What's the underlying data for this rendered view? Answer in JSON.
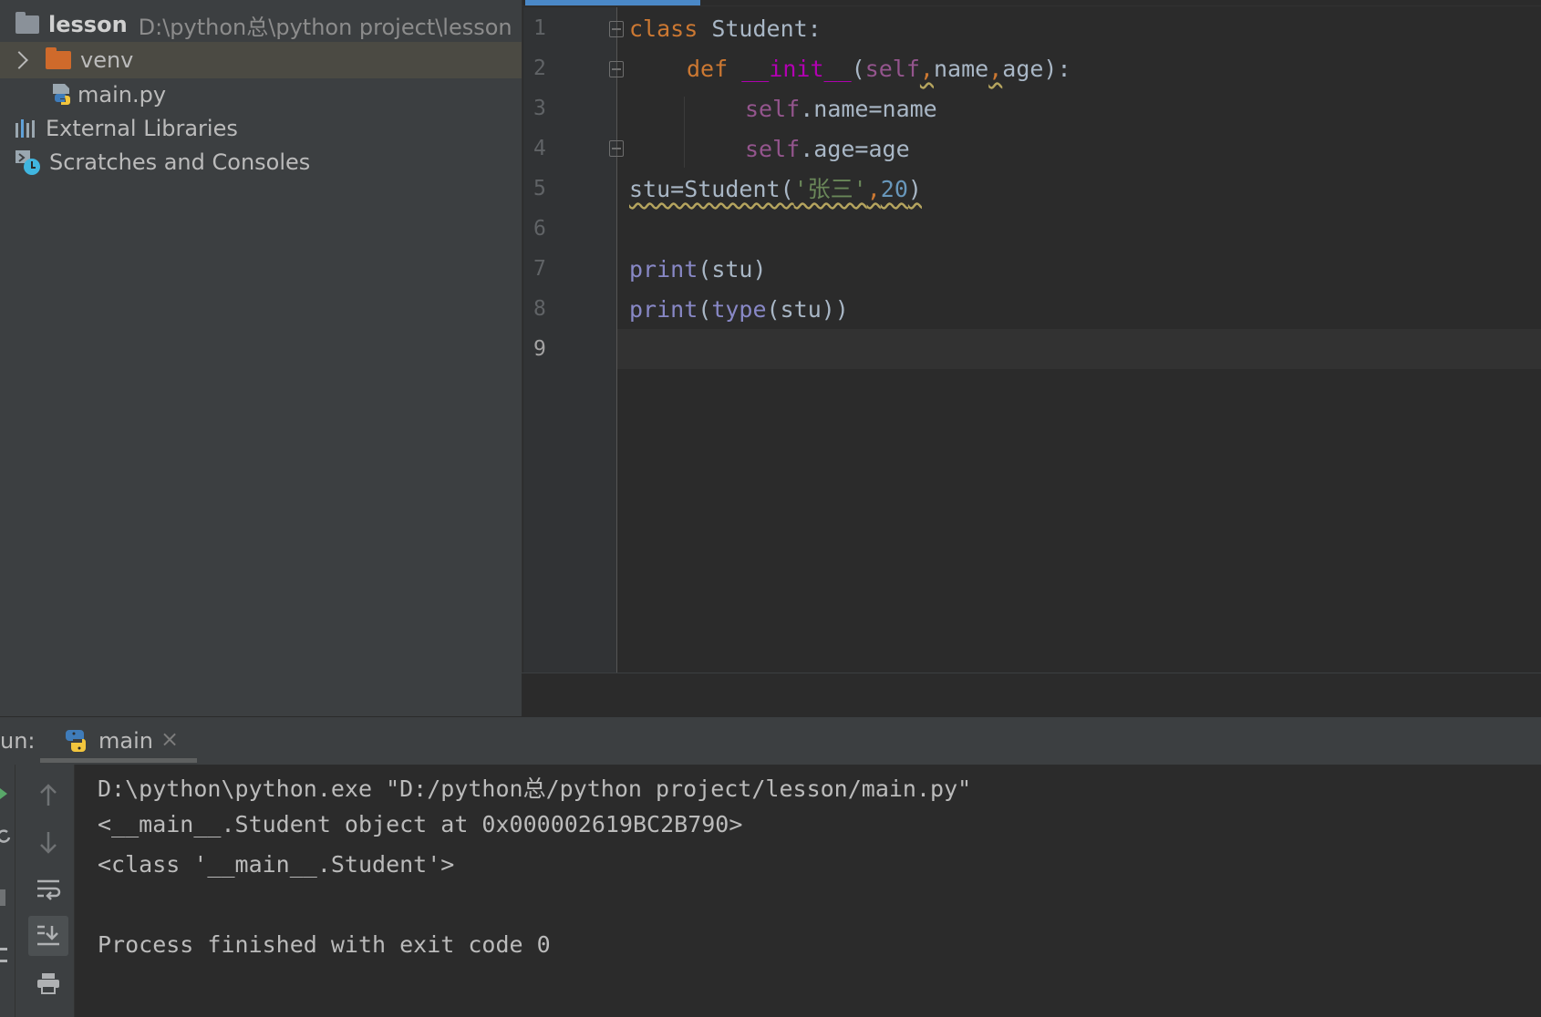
{
  "project_tree": {
    "root": {
      "name": "lesson",
      "path": "D:\\python总\\python project\\lesson"
    },
    "items": [
      {
        "label": "venv",
        "icon": "folder-icon"
      },
      {
        "label": "main.py",
        "icon": "python-file-icon"
      },
      {
        "label": "External Libraries",
        "icon": "library-icon"
      },
      {
        "label": "Scratches and Consoles",
        "icon": "scratches-icon"
      }
    ]
  },
  "editor": {
    "line_numbers": [
      "1",
      "2",
      "3",
      "4",
      "5",
      "6",
      "7",
      "8",
      "9"
    ],
    "current_line": "9",
    "code": {
      "l1": {
        "kw": "class",
        "name": " Student:"
      },
      "l2": {
        "kw": "def",
        "fn": "__init__",
        "open": "(",
        "self": "self",
        "c1": ",",
        "p1": "name",
        "c2": ",",
        "p2": "age",
        "close": "):"
      },
      "l3": {
        "self": "self",
        "rest": ".name=name"
      },
      "l4": {
        "self": "self",
        "rest": ".age=age"
      },
      "l5": {
        "pre": "stu=Student(",
        "str": "'张三'",
        "comma": ",",
        "num": "20",
        "post": ")"
      },
      "l7": {
        "bi": "print",
        "rest": "(stu)"
      },
      "l8": {
        "bi": "print",
        "open": "(",
        "bi2": "type",
        "rest": "(stu))"
      }
    }
  },
  "run": {
    "label": "un:",
    "tab": "main",
    "tab_close": "×",
    "output": [
      "D:\\python\\python.exe \"D:/python总/python project/lesson/main.py\"",
      "<__main__.Student object at 0x000002619BC2B790>",
      "<class '__main__.Student'>",
      "",
      "Process finished with exit code 0"
    ]
  },
  "colors": {
    "keyword": "#cc7832",
    "function": "#b200b2",
    "self": "#94558d",
    "builtin": "#8888c6",
    "string": "#6a8759",
    "number": "#6897bb",
    "sidebar_bg": "#3c3f41",
    "editor_bg": "#2b2b2b",
    "selection": "#4b4a43"
  }
}
